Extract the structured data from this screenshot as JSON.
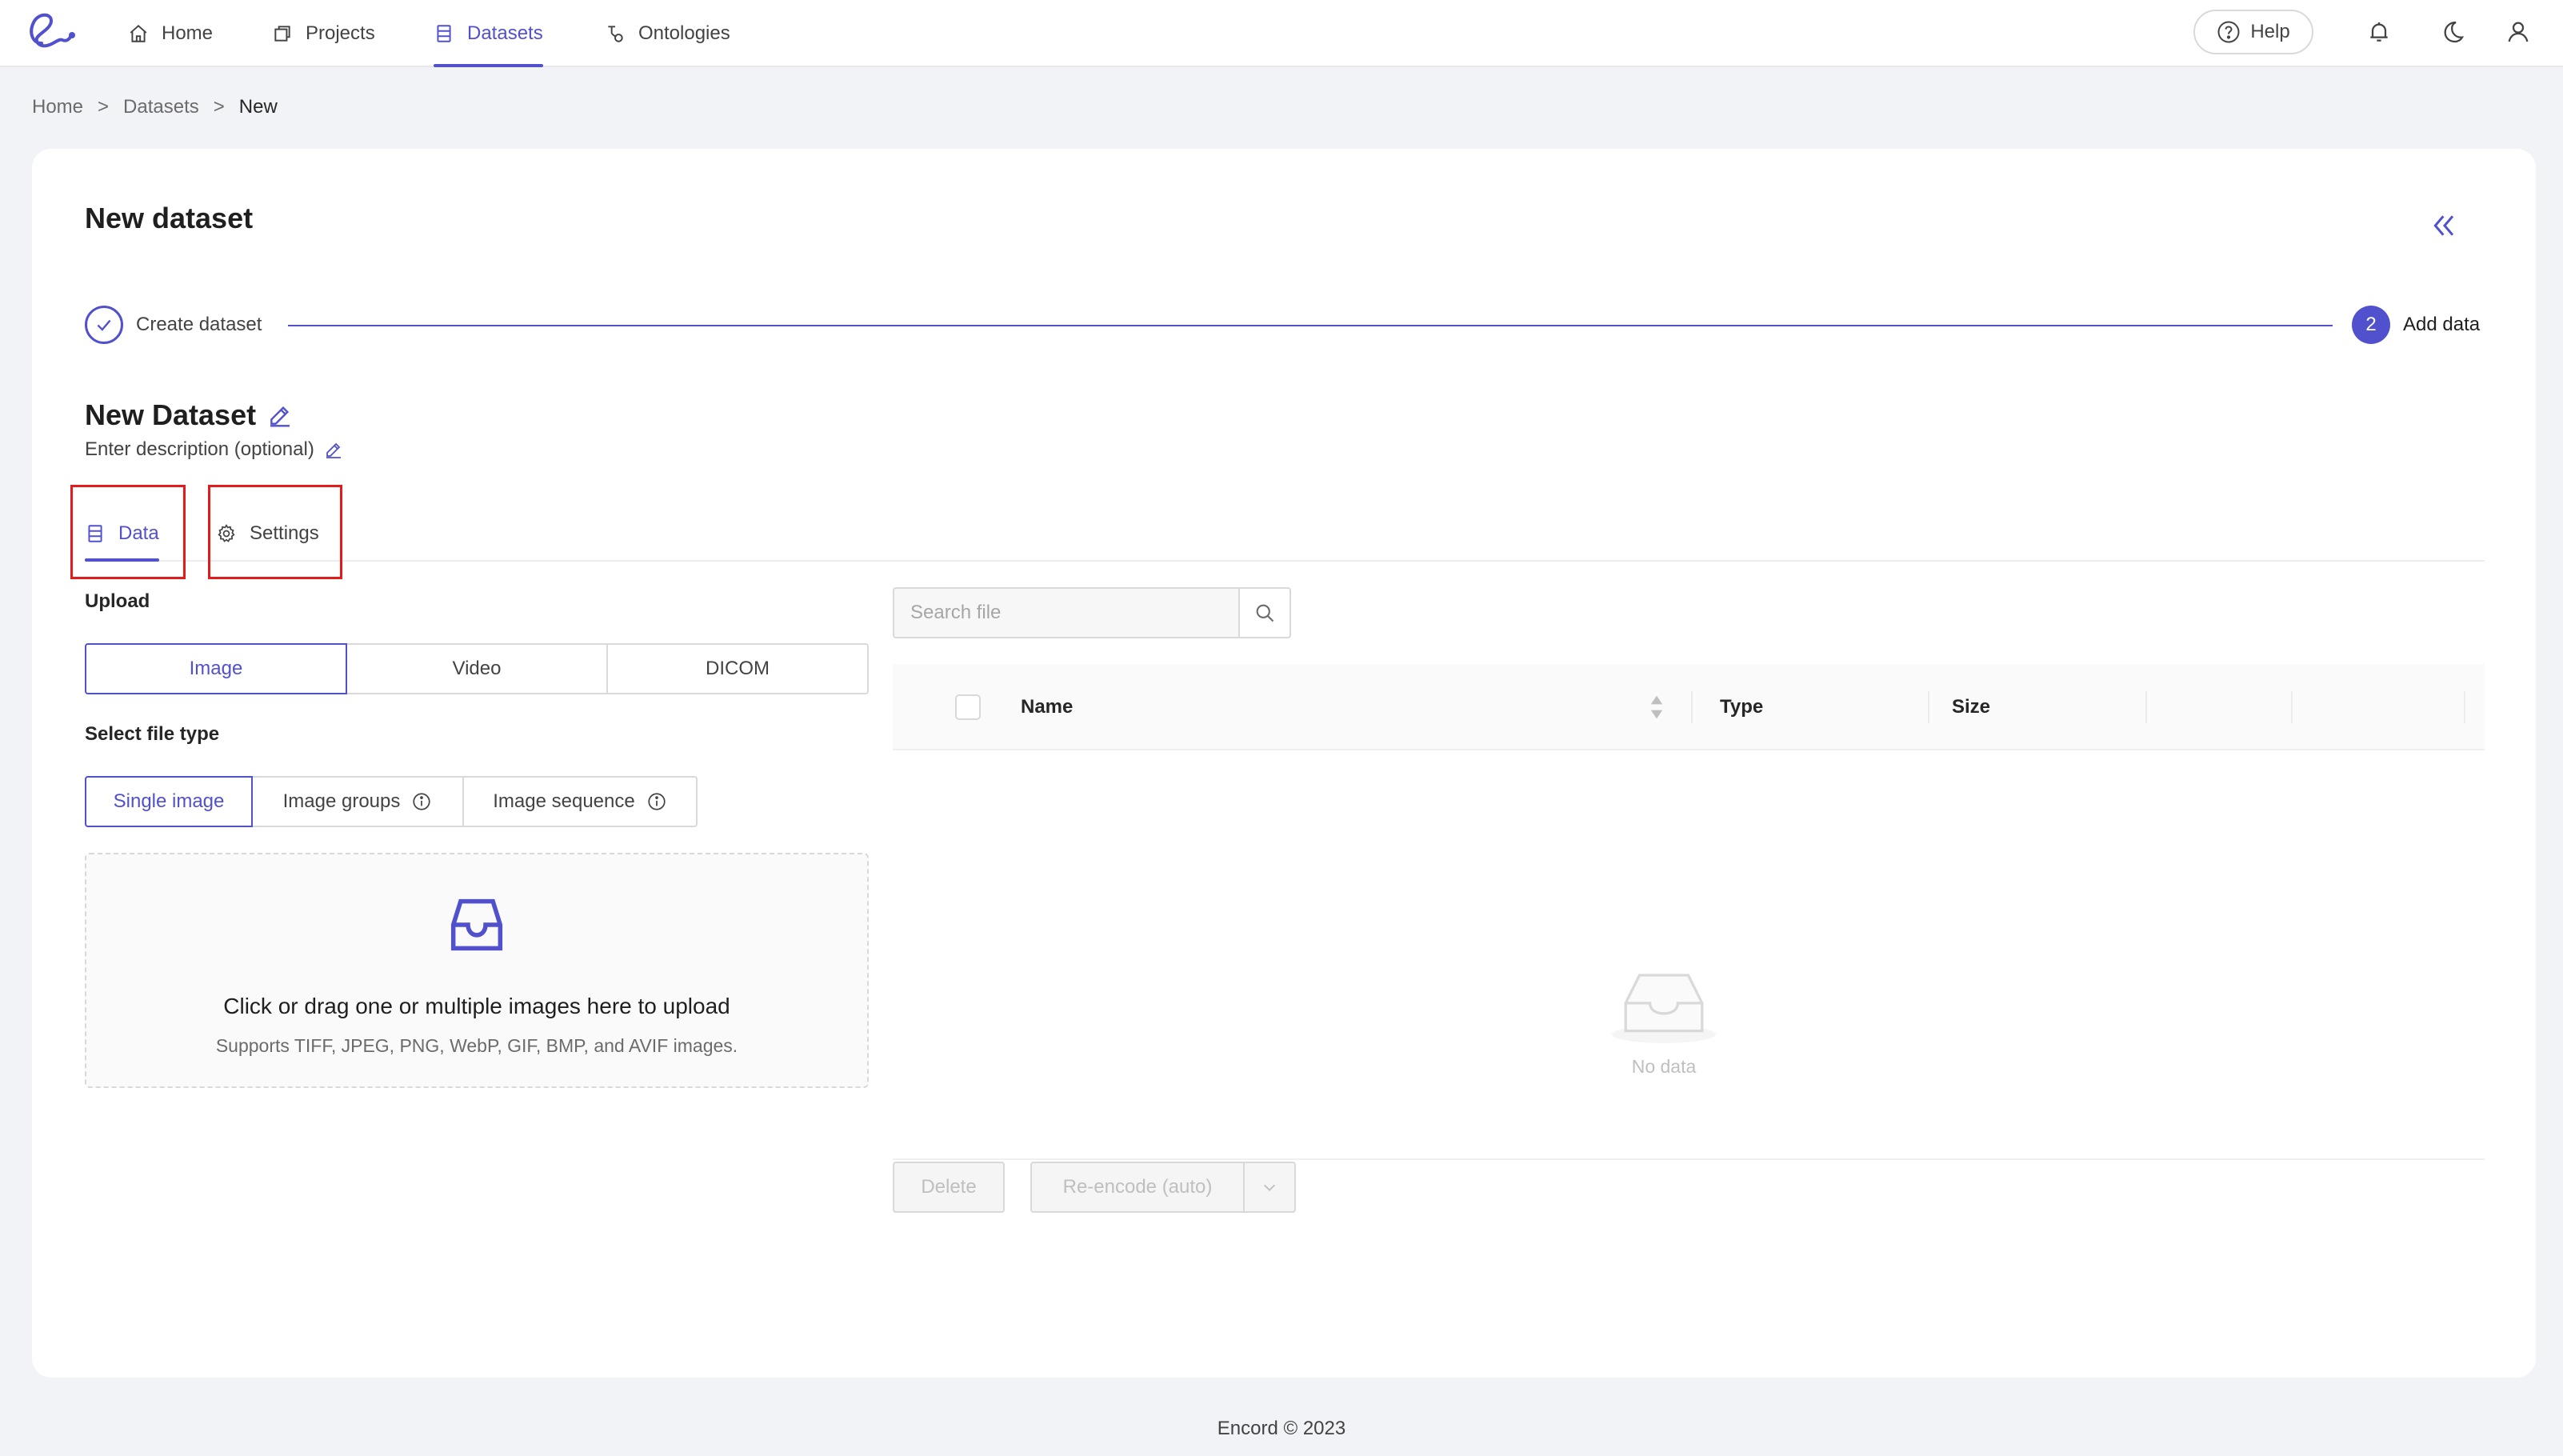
{
  "nav": {
    "items": [
      {
        "label": "Home",
        "icon": "home-icon"
      },
      {
        "label": "Projects",
        "icon": "projects-icon"
      },
      {
        "label": "Datasets",
        "icon": "datasets-icon",
        "active": true
      },
      {
        "label": "Ontologies",
        "icon": "ontologies-icon"
      }
    ],
    "help_label": "Help",
    "accent_color": "#5151cd"
  },
  "breadcrumb": [
    "Home",
    "Datasets",
    "New"
  ],
  "page": {
    "title": "New dataset"
  },
  "stepper": {
    "step1_label": "Create dataset",
    "step2_number": "2",
    "step2_label": "Add data"
  },
  "dataset": {
    "name": "New Dataset",
    "description": "Enter description (optional)"
  },
  "tabs": [
    {
      "label": "Data",
      "icon": "database-icon",
      "active": true
    },
    {
      "label": "Settings",
      "icon": "gear-icon",
      "active": false
    }
  ],
  "upload": {
    "label": "Upload",
    "media_types": [
      "Image",
      "Video",
      "DICOM"
    ],
    "selected_media": "Image",
    "file_type_label": "Select file type",
    "file_types": [
      "Single image",
      "Image groups",
      "Image sequence"
    ],
    "selected_file_type": "Single image",
    "dropzone_title": "Click or drag one or multiple images here to upload",
    "dropzone_subtitle": "Supports TIFF, JPEG, PNG, WebP, GIF, BMP, and AVIF images."
  },
  "files": {
    "search_placeholder": "Search file",
    "columns": [
      "Name",
      "Type",
      "Size"
    ],
    "rows": [],
    "empty_text": "No data",
    "delete_label": "Delete",
    "reencode_label": "Re-encode (auto)"
  },
  "footer": "Encord © 2023"
}
